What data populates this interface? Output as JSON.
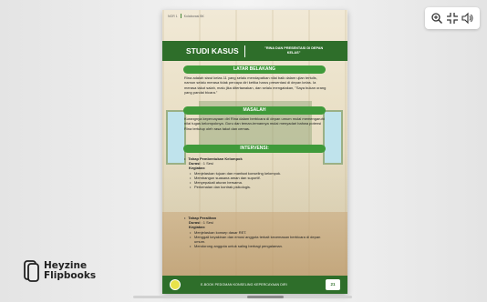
{
  "toolbar": {
    "zoom_icon": "zoom-in-icon",
    "fullscreen_icon": "exit-fullscreen-icon",
    "sound_icon": "speaker-icon"
  },
  "branding": {
    "line1": "Heyzine",
    "line2": "Flipbooks"
  },
  "page": {
    "header_left": "NOR 1",
    "header_right": "Kolaborasi BK",
    "studi_title": "STUDI KASUS",
    "studi_subtitle": "\"RINA DAN PRESENTASI DI DEPAN KELAS\"",
    "sections": {
      "latar_title": "LATAR BELAKANG",
      "latar_text": "Rina adalah siswi kelas 11 yang selalu mendapatkan nilai baik dalam ujian tertulis, namun selalu merasa tidak percaya diri ketika harus presentasi di depan kelas. Ia merasa takut salah, malu jika ditertawakan, dan selalu mengatakan, \"Saya bukan orang yang pandai bicara.\"",
      "masalah_title": "MASALAH",
      "masalah_text": "Kurangnya kepercayaan diri Rina dalam berbicara di depan umum mulai memengaruhi nilai tugas kelompoknya. Guru dan teman-temannya mulai menyadari bahwa potensi Rina tertutup oleh rasa takut dan cemas.",
      "intervensi_title": "INTERVENSI:"
    },
    "phases": [
      {
        "title": "Tahap Pembentukan Kelompok",
        "durasi_label": "Durasi",
        "durasi_value": ": 1 Sesi",
        "kegiatan_label": "Kegiatan:",
        "items": [
          "Menjelaskan tujuan dan manfaat konseling kelompok.",
          "Membangun suasana aman dan suportif.",
          "Menyepakati aturan bersama.",
          "Perkenalan dan kontrak psikologis."
        ]
      },
      {
        "title": "Tahap Peralihan",
        "durasi_label": "Durasi",
        "durasi_value": ": 1 Sesi",
        "kegiatan_label": "Kegiatan:",
        "items": [
          "Menjelaskan konsep dasar RET.",
          "Menggali keyakinan dan emosi anggota terkait kecemasan berbicara di depan umum.",
          "Mendorong anggota untuk saling berbagi pengalaman."
        ]
      }
    ],
    "footer_text": "E-BOOK PEDOMAN KONSELING KEPERCAYAAN DIRI",
    "page_number": "21"
  },
  "colors": {
    "primary_green": "#2e6e2a",
    "pill_green": "#3f9a3a"
  }
}
